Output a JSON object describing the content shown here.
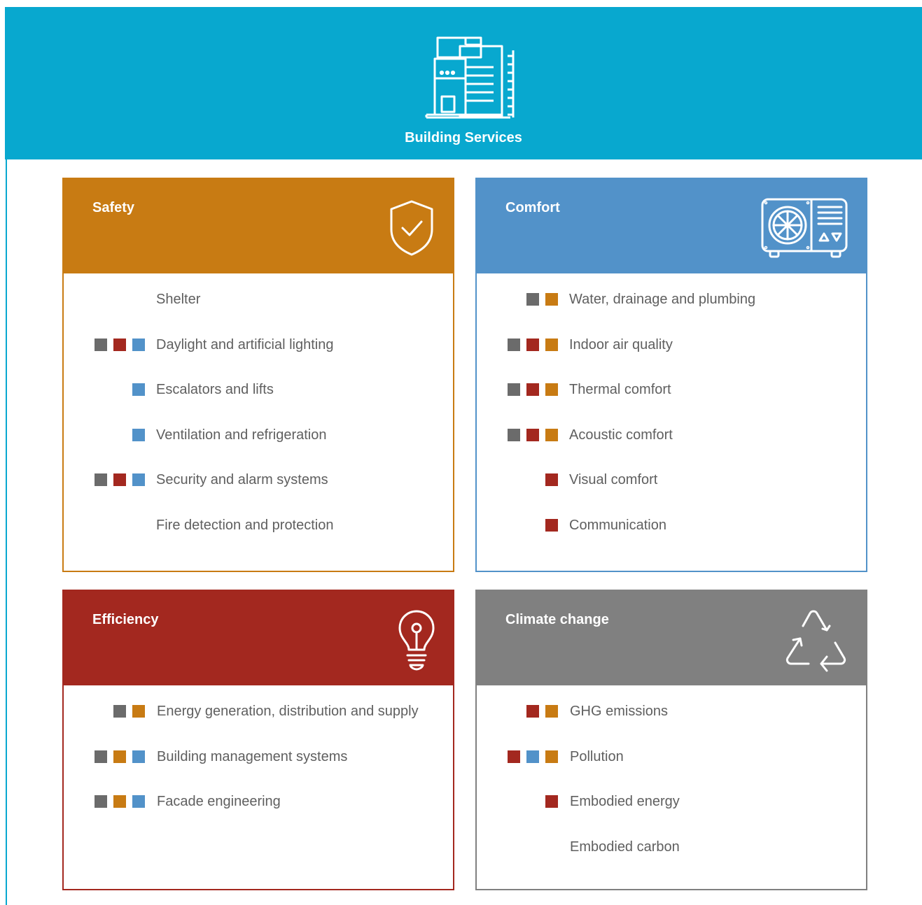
{
  "header": {
    "title": "Building Services",
    "icon": "building-icon",
    "color": "#08a8cf"
  },
  "colors": {
    "dark_grey": "#6b6b6b",
    "red": "#a3281f",
    "blue": "#5292c9",
    "orange": "#c87b13"
  },
  "cards": {
    "safety": {
      "title": "Safety",
      "icon": "shield-check-icon",
      "color": "#c87b13",
      "items": [
        {
          "label": "Shelter",
          "markers": []
        },
        {
          "label": "Daylight and artificial lighting",
          "markers": [
            "dark_grey",
            "red",
            "blue"
          ]
        },
        {
          "label": "Escalators and lifts",
          "markers": [
            "blue"
          ]
        },
        {
          "label": "Ventilation and refrigeration",
          "markers": [
            "blue"
          ]
        },
        {
          "label": "Security and alarm systems",
          "markers": [
            "dark_grey",
            "red",
            "blue"
          ]
        },
        {
          "label": "Fire detection and protection",
          "markers": []
        }
      ]
    },
    "comfort": {
      "title": "Comfort",
      "icon": "air-conditioner-icon",
      "color": "#5292c9",
      "items": [
        {
          "label": "Water, drainage and plumbing",
          "markers": [
            "dark_grey",
            "orange"
          ]
        },
        {
          "label": "Indoor air quality",
          "markers": [
            "dark_grey",
            "red",
            "orange"
          ]
        },
        {
          "label": "Thermal comfort",
          "markers": [
            "dark_grey",
            "red",
            "orange"
          ]
        },
        {
          "label": "Acoustic comfort",
          "markers": [
            "dark_grey",
            "red",
            "orange"
          ]
        },
        {
          "label": "Visual comfort",
          "markers": [
            "red"
          ]
        },
        {
          "label": "Communication",
          "markers": [
            "red"
          ]
        }
      ]
    },
    "efficiency": {
      "title": "Efficiency",
      "icon": "lightbulb-icon",
      "color": "#a3281f",
      "items": [
        {
          "label": "Energy generation, distribution and supply",
          "markers": [
            "dark_grey",
            "orange"
          ]
        },
        {
          "label": "Building management systems",
          "markers": [
            "dark_grey",
            "orange",
            "blue"
          ]
        },
        {
          "label": "Facade engineering",
          "markers": [
            "dark_grey",
            "orange",
            "blue"
          ]
        }
      ]
    },
    "climate": {
      "title": "Climate change",
      "icon": "recycle-icon",
      "color": "#808080",
      "items": [
        {
          "label": "GHG emissions",
          "markers": [
            "red",
            "orange"
          ]
        },
        {
          "label": "Pollution",
          "markers": [
            "red",
            "blue",
            "orange"
          ]
        },
        {
          "label": "Embodied energy",
          "markers": [
            "red"
          ]
        },
        {
          "label": "Embodied carbon",
          "markers": []
        }
      ]
    }
  }
}
